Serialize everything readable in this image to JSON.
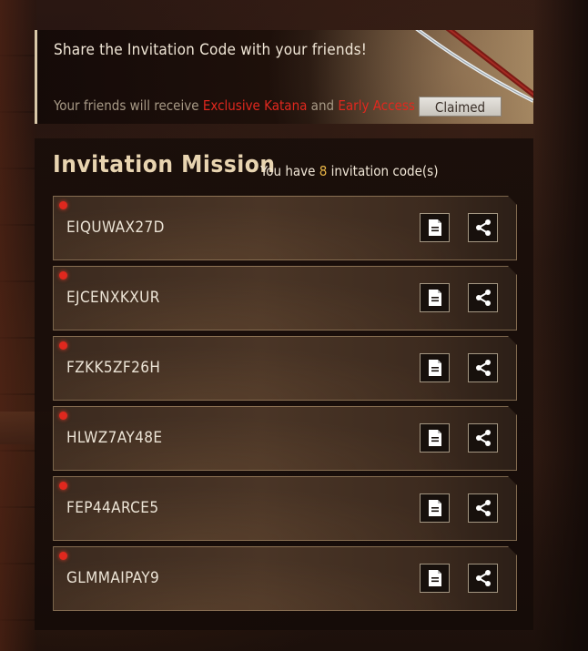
{
  "banner": {
    "title": "Share the Invitation Code with your friends!",
    "desc_prefix": "Your friends will receive ",
    "reward_1": "Exclusive Katana",
    "desc_and": " and ",
    "reward_2": "Early Access",
    "claimed_label": "Claimed"
  },
  "mission": {
    "title": "Invitation Mission",
    "sub_prefix": "You have ",
    "count": "8",
    "sub_suffix": " invitation code(s)"
  },
  "codes": [
    {
      "code": "EIQUWAX27D"
    },
    {
      "code": "EJCENXKXUR"
    },
    {
      "code": "FZKK5ZF26H"
    },
    {
      "code": "HLWZ7AY48E"
    },
    {
      "code": "FEP44ARCE5"
    },
    {
      "code": "GLMMAIPAY9"
    }
  ],
  "icons": {
    "copy": "copy-icon",
    "share": "share-icon"
  },
  "colors": {
    "highlight_red": "#e0281e",
    "count_gold": "#e8b547",
    "title_gold": "#e8d4b0"
  }
}
